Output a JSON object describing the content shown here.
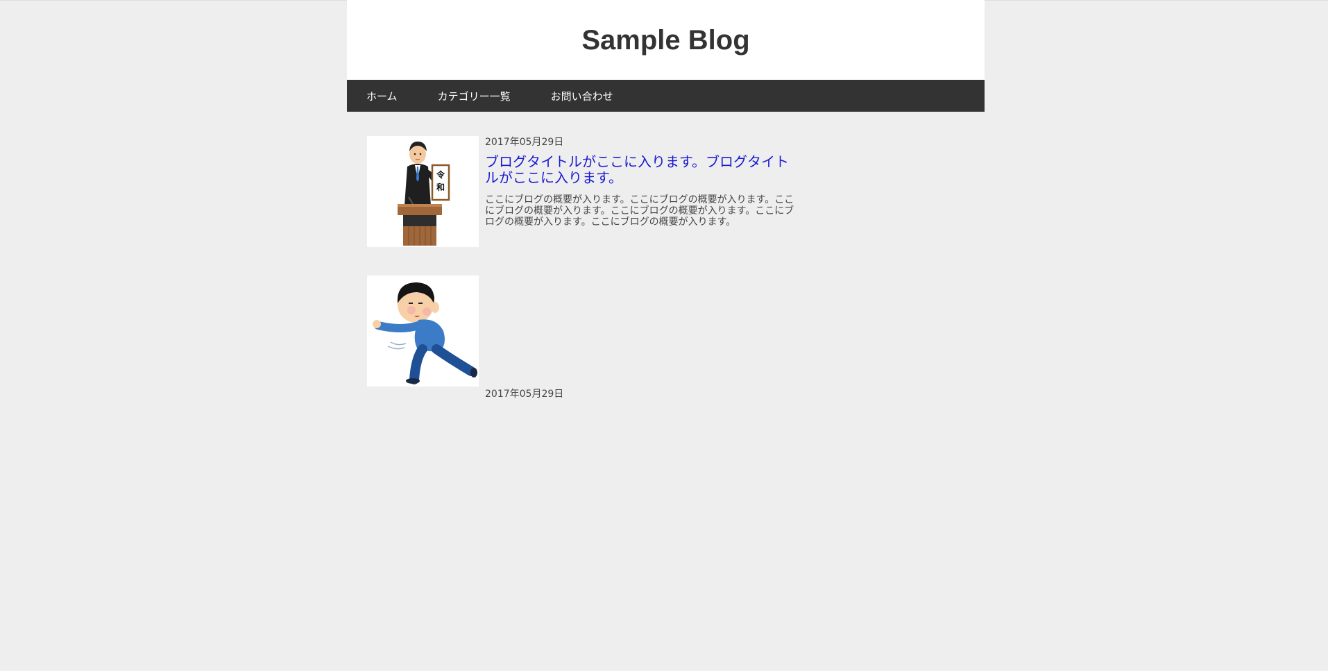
{
  "site": {
    "title": "Sample Blog"
  },
  "nav": {
    "items": [
      {
        "label": "ホーム"
      },
      {
        "label": "カテゴリー一覧"
      },
      {
        "label": "お問い合わせ"
      }
    ]
  },
  "posts": [
    {
      "date": "2017年05月29日",
      "title": "ブログタイトルがここに入ります。ブログタイトルがここに入ります。",
      "excerpt": "ここにブログの概要が入ります。ここにブログの概要が入ります。ここにブログの概要が入ります。ここにブログの概要が入ります。ここにブログの概要が入ります。ここにブログの概要が入ります。",
      "image_icon": "reiwa-announcement-icon",
      "image_sign_text": "令和"
    },
    {
      "date": "2017年05月29日",
      "image_icon": "running-man-icon"
    }
  ],
  "colors": {
    "page_bg": "#eeeeee",
    "header_bg": "#ffffff",
    "nav_bg": "#333333",
    "link": "#1a1ad4",
    "text": "#333333"
  }
}
